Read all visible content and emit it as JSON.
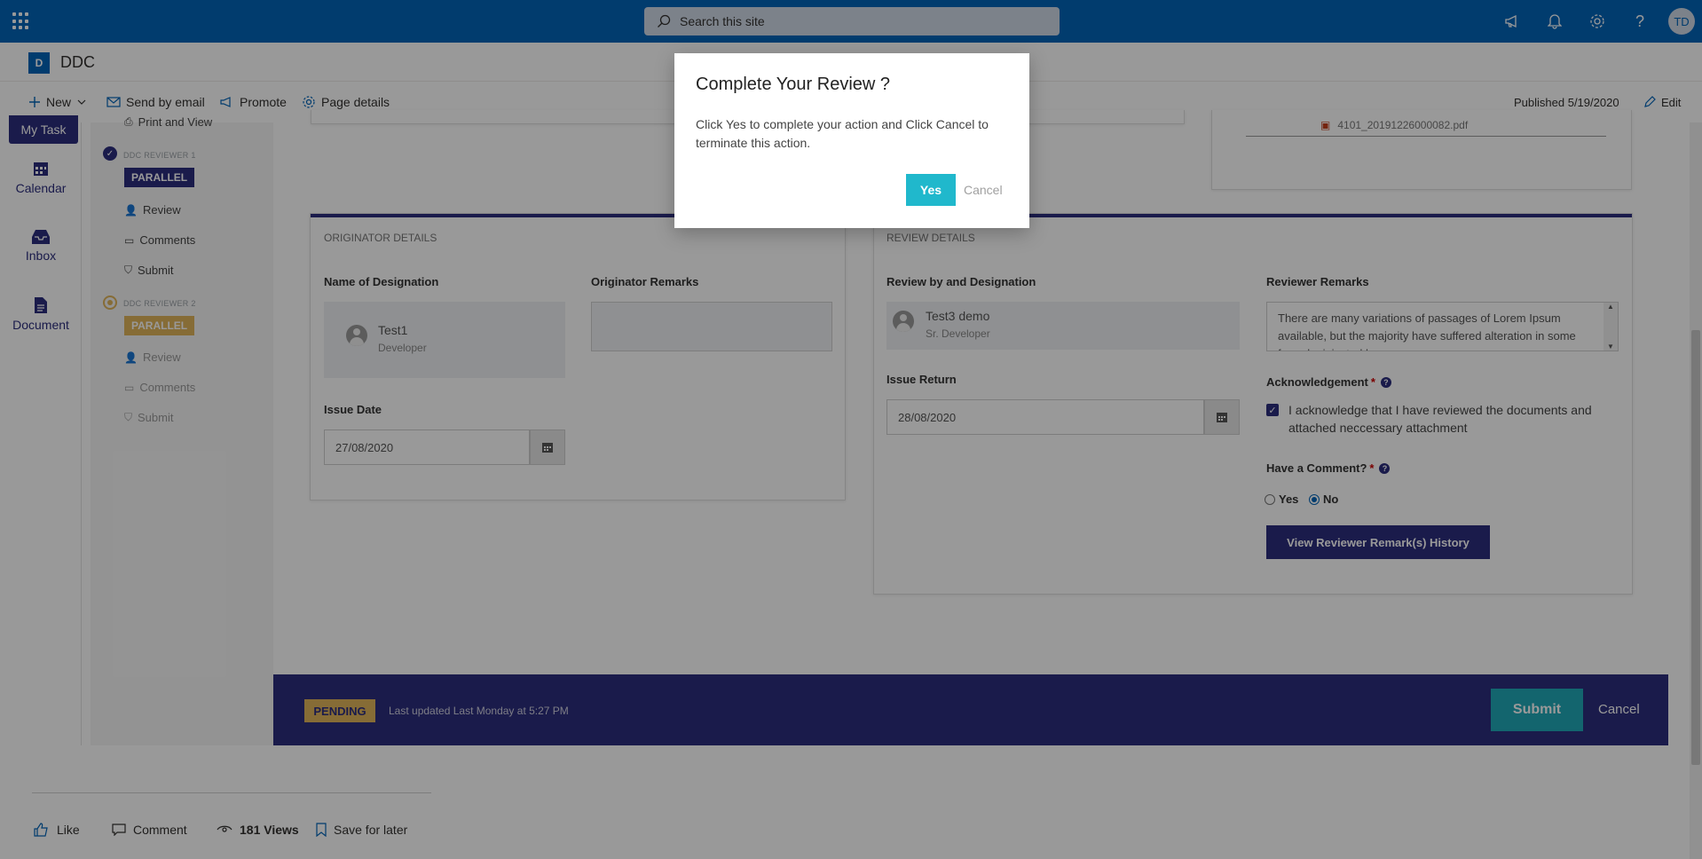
{
  "suite": {
    "search_placeholder": "Search this site",
    "avatar_initials": "TD"
  },
  "site": {
    "logo_letter": "D",
    "name": "DDC"
  },
  "commandbar": {
    "new": "New",
    "send_by_email": "Send by email",
    "promote": "Promote",
    "page_details": "Page details",
    "published": "Published 5/19/2020",
    "edit": "Edit"
  },
  "leftnav": {
    "my_task": "My Task",
    "items": [
      {
        "label": "Calendar"
      },
      {
        "label": "Inbox"
      },
      {
        "label": "Document"
      }
    ]
  },
  "workflow": {
    "print_view": "Print and View",
    "reviewer1": {
      "header": "DDC REVIEWER 1",
      "badge": "PARALLEL",
      "steps": [
        "Review",
        "Comments",
        "Submit"
      ]
    },
    "reviewer2": {
      "header": "DDC REVIEWER 2",
      "badge": "PARALLEL",
      "steps": [
        "Review",
        "Comments",
        "Submit"
      ]
    }
  },
  "top_attachment": "4101_20191226000082.pdf",
  "originator": {
    "section_title": "ORIGINATOR DETAILS",
    "name_label": "Name of Designation",
    "person_name": "Test1",
    "person_role": "Developer",
    "remarks_label": "Originator Remarks",
    "issue_date_label": "Issue Date",
    "issue_date": "27/08/2020"
  },
  "review": {
    "section_title": "REVIEW DETAILS",
    "reviewer_label": "Review by and Designation",
    "person_name": "Test3 demo",
    "person_role": "Sr. Developer",
    "issue_return_label": "Issue Return",
    "issue_return": "28/08/2020",
    "remarks_label": "Reviewer Remarks",
    "remarks_text": "There are many variations of passages of Lorem Ipsum available, but the majority have suffered alteration in some form, by injected humour",
    "ack_label": "Acknowledgement",
    "ack_text": "I acknowledge that I have reviewed the documents and attached neccessary attachment",
    "comment_label": "Have a Comment?",
    "yes": "Yes",
    "no": "No",
    "history_button": "View Reviewer Remark(s) History"
  },
  "footer": {
    "status": "PENDING",
    "last_updated": "Last updated Last Monday at 5:27 PM",
    "submit": "Submit",
    "cancel": "Cancel"
  },
  "social": {
    "like": "Like",
    "comment": "Comment",
    "views": "181 Views",
    "save_later": "Save for later"
  },
  "modal": {
    "title": "Complete Your Review ?",
    "body": "Click Yes to complete your action and Click Cancel to terminate this action.",
    "yes": "Yes",
    "cancel": "Cancel"
  },
  "colors": {
    "suite_blue": "#0364b8",
    "brand_navy": "#2c2d7d",
    "teal": "#20a9b8",
    "pending_gold": "#e0b45a"
  }
}
